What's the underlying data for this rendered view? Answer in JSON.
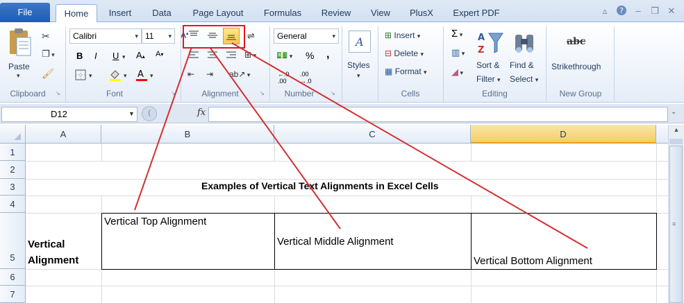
{
  "tabs": {
    "file": "File",
    "items": [
      "Home",
      "Insert",
      "Data",
      "Page Layout",
      "Formulas",
      "Review",
      "View",
      "PlusX",
      "Expert PDF"
    ],
    "active": "Home"
  },
  "clipboard": {
    "paste": "Paste",
    "label": "Clipboard"
  },
  "font": {
    "name": "Calibri",
    "size": "11",
    "label": "Font",
    "bold": "B",
    "italic": "I",
    "underline": "U"
  },
  "alignment": {
    "label": "Alignment"
  },
  "number": {
    "format": "General",
    "label": "Number",
    "percent": "%",
    "comma": ","
  },
  "styles": {
    "label": "Styles"
  },
  "cells": {
    "insert": "Insert",
    "delete": "Delete",
    "format": "Format",
    "label": "Cells"
  },
  "editing": {
    "sort": "Sort &",
    "filter": "Filter",
    "find": "Find &",
    "select": "Select",
    "label": "Editing",
    "sigma": "Σ"
  },
  "newgroup": {
    "strike": "Strikethrough",
    "strike_icon": "abc",
    "label": "New Group"
  },
  "formula_bar": {
    "name_box": "D12",
    "fx": "fx",
    "content": ""
  },
  "columns": [
    "A",
    "B",
    "C",
    "D"
  ],
  "selected_column": "D",
  "rows": [
    "1",
    "2",
    "3",
    "4",
    "5",
    "6",
    "7"
  ],
  "sheet": {
    "title": "Examples of Vertical Text Alignments in Excel Cells",
    "a5_line1": "Vertical",
    "a5_line2": "Alignment",
    "b5": "Vertical Top Alignment",
    "c5": "Vertical Middle Alignment",
    "d5": "Vertical Bottom Alignment"
  },
  "colors": {
    "annotation": "#d32f2f",
    "selected_header": "#f5cc6b",
    "file_tab": "#2a66bd"
  }
}
